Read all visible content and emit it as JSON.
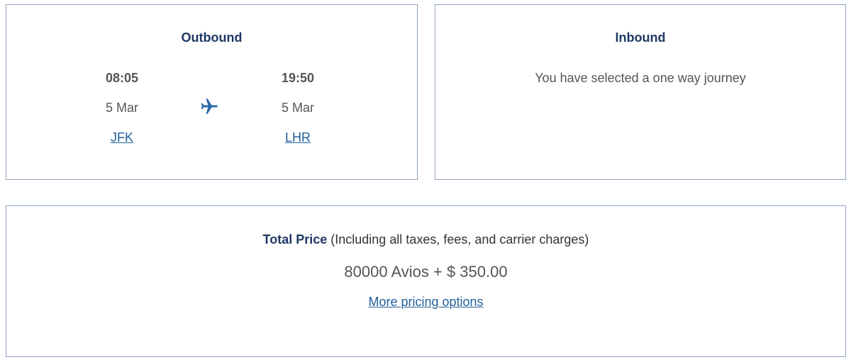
{
  "outbound": {
    "title": "Outbound",
    "departure": {
      "time": "08:05",
      "date": "5 Mar",
      "airport": "JFK"
    },
    "arrival": {
      "time": "19:50",
      "date": "5 Mar",
      "airport": "LHR"
    },
    "icon": "airplane-icon"
  },
  "inbound": {
    "title": "Inbound",
    "message": "You have selected a one way journey"
  },
  "price": {
    "label": "Total Price",
    "note": " (Including all taxes, fees, and carrier charges)",
    "amount": "80000 Avios + $ 350.00",
    "more_options": "More pricing options"
  },
  "colors": {
    "title": "#1f3864",
    "text": "#555555",
    "link": "#1f5f9a",
    "border": "#8ea4bd",
    "icon": "#2e6aa8"
  }
}
